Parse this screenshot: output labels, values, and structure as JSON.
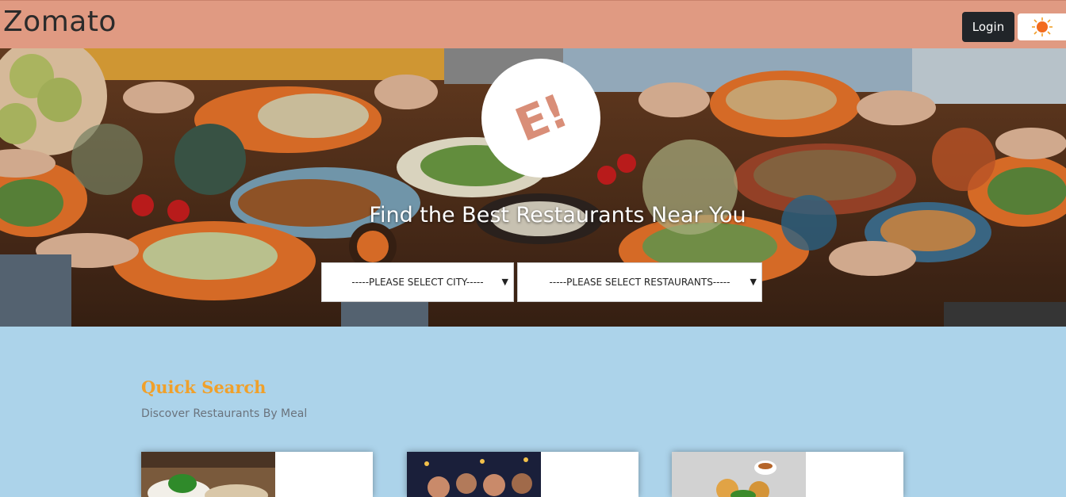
{
  "header": {
    "brand": "Zomato",
    "login_label": "Login",
    "theme_icon": "sun-icon",
    "accent_color": "#e09a82"
  },
  "hero": {
    "logo_text": "E!",
    "title": "Find the Best Restaurants Near You",
    "city_select": {
      "selected": "-----PLEASE SELECT CITY-----"
    },
    "restaurant_select": {
      "selected": "-----PLEASE SELECT RESTAURANTS-----"
    }
  },
  "quick_search": {
    "title": "Quick Search",
    "subtitle": "Discover Restaurants By Meal",
    "title_color": "#f0a02a",
    "cards": [
      {
        "image": "meal-image-rice-bowl"
      },
      {
        "image": "meal-image-nightlife"
      },
      {
        "image": "meal-image-breakfast"
      }
    ]
  }
}
